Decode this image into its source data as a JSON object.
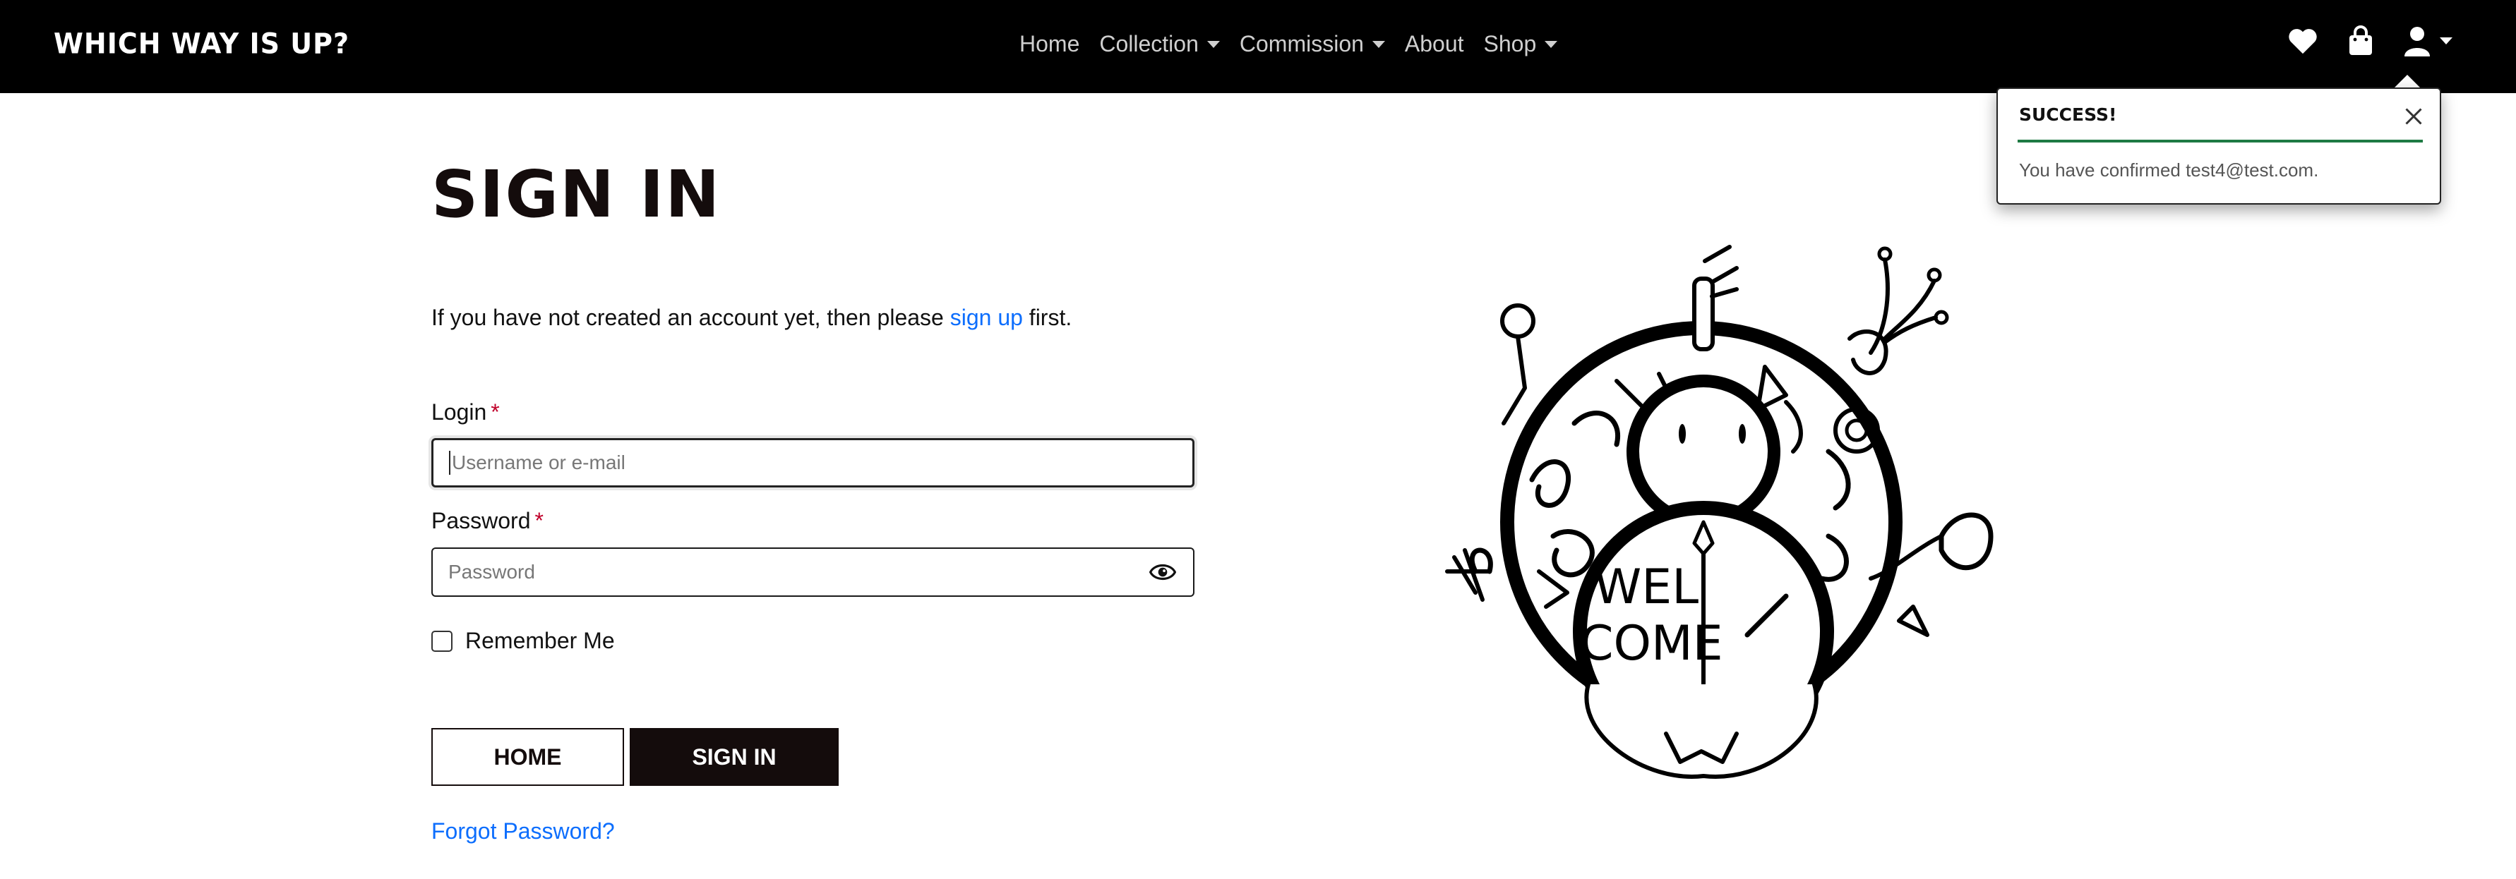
{
  "navbar": {
    "brand": "WHICH WAY IS UP?",
    "links": [
      {
        "label": "Home",
        "dropdown": false
      },
      {
        "label": "Collection",
        "dropdown": true
      },
      {
        "label": "Commission",
        "dropdown": true
      },
      {
        "label": "About",
        "dropdown": false
      },
      {
        "label": "Shop",
        "dropdown": true
      }
    ],
    "icons": [
      "heart-icon",
      "shopping-bag-icon",
      "user-icon"
    ]
  },
  "main": {
    "title": "SIGN IN",
    "intro_before": "If you have not created an account yet, then please ",
    "intro_link": "sign up",
    "intro_after": " first.",
    "login_label": "Login",
    "login_placeholder": "Username or e-mail",
    "password_label": "Password",
    "password_placeholder": "Password",
    "required_mark": "*",
    "remember_label": "Remember Me",
    "home_button": "HOME",
    "signin_button": "SIGN IN",
    "forgot_link": "Forgot Password?"
  },
  "illustration": {
    "text_line1": "WEL",
    "text_line2": "COME"
  },
  "toast": {
    "title": "SUCCESS!",
    "message": "You have confirmed test4@test.com.",
    "accent_color": "#1e7a44"
  },
  "colors": {
    "navbar_bg": "#000000",
    "link": "#0d6efd",
    "primary_button": "#140c0c",
    "required": "#c0002a"
  }
}
